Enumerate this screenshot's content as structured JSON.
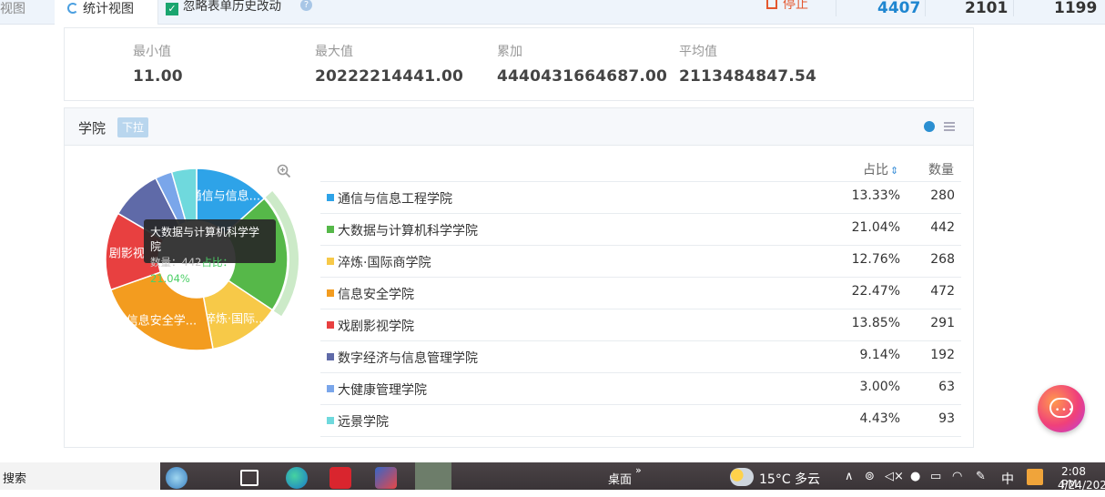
{
  "top": {
    "tab_view": "视图",
    "tab_stats": "统计视图",
    "ignore_checkbox_label": "忽略表单历史改动",
    "stop_label": "停止",
    "counts": [
      "4407",
      "2101",
      "1199"
    ],
    "count_colors": [
      "#1f86d0",
      "#333333",
      "#333333"
    ]
  },
  "summary": {
    "min_label": "最小值",
    "min_value": "11.00",
    "max_label": "最大值",
    "max_value": "20222214441.00",
    "sum_label": "累加",
    "sum_value": "4440431664687.00",
    "avg_label": "平均值",
    "avg_value": "2113484847.54"
  },
  "panel": {
    "title": "学院",
    "dropdown_tag": "下拉",
    "col_ratio": "占比",
    "col_count": "数量"
  },
  "chart_data": {
    "type": "pie",
    "donut": true,
    "categories": [
      "通信与信息工程学院",
      "大数据与计算机科学学院",
      "淬炼·国际商学院",
      "信息安全学院",
      "戏剧影视学院",
      "数字经济与信息管理学院",
      "大健康管理学院",
      "远景学院"
    ],
    "values": [
      280,
      442,
      268,
      472,
      291,
      192,
      63,
      93
    ],
    "percents": [
      "13.33%",
      "21.04%",
      "12.76%",
      "22.47%",
      "13.85%",
      "9.14%",
      "3.00%",
      "4.43%"
    ],
    "colors": [
      "#2ea3e8",
      "#56b849",
      "#f7c948",
      "#f39c1f",
      "#e84040",
      "#5f6aa8",
      "#7aa6ea",
      "#6fd9dd"
    ],
    "slice_labels": [
      "通信与信息...",
      "",
      "淬炼·国际...",
      "信息安全学...",
      "剧影视",
      "",
      "",
      ""
    ],
    "highlighted_index": 1
  },
  "tooltip": {
    "title": "大数据与计算机科学学院",
    "count_text": "数量：442",
    "pct_text": "占比：21.04%"
  },
  "taskbar": {
    "search": "搜索",
    "desktop": "桌面",
    "weather": "15°C 多云",
    "ime": "中",
    "time": "2:08 PM",
    "date": "4/24/202"
  }
}
